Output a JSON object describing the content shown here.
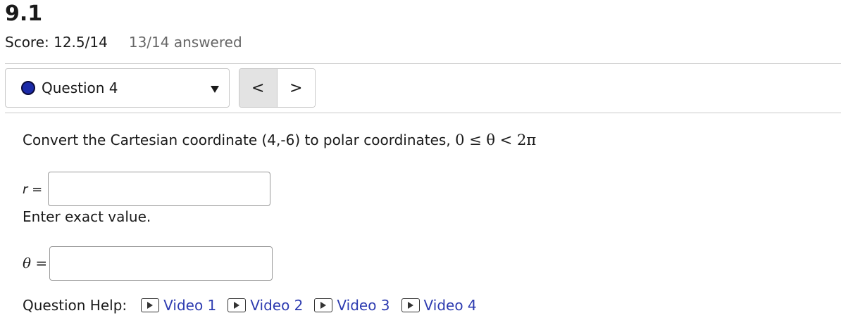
{
  "header": {
    "title": "9.1",
    "score": "Score: 12.5/14",
    "answered": "13/14 answered"
  },
  "question_nav": {
    "selected": "Question 4",
    "prev_label": "<",
    "next_label": ">"
  },
  "question": {
    "prompt": "Convert the Cartesian coordinate (4,-6) to polar coordinates,",
    "range_math": "0 ≤ θ < 2π",
    "r_label_var": "r",
    "r_label_eq": " =",
    "r_value": "",
    "hint": "Enter exact value.",
    "theta_label_var": "θ",
    "theta_label_eq": " =",
    "theta_value": ""
  },
  "help": {
    "label": "Question Help:",
    "videos": [
      "Video 1",
      "Video 2",
      "Video 3",
      "Video 4"
    ]
  },
  "colors": {
    "status_dot": "#1b2aa8",
    "link": "#2d3bb0"
  },
  "icons": {
    "status": "status-dot-icon",
    "dropdown": "caret-down-icon",
    "video": "video-play-icon"
  }
}
